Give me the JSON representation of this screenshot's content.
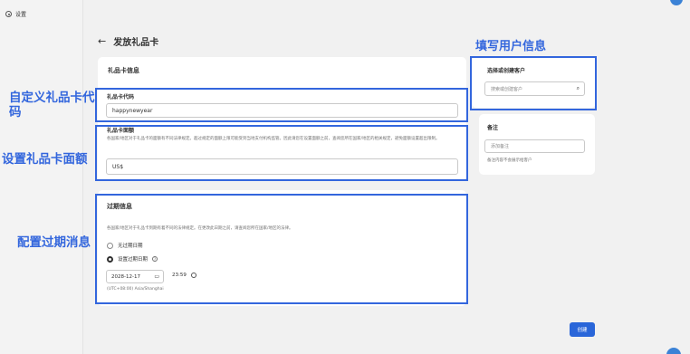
{
  "sidebar": {
    "settings_label": "设置",
    "settings_icon": "gear-icon"
  },
  "header": {
    "back_icon": "arrow-left-icon",
    "title": "发放礼品卡"
  },
  "gift_card_info": {
    "title": "礼品卡信息",
    "code_label": "礼品卡代码",
    "code_value": "happynewyear",
    "value_label": "礼品卡面额",
    "value_help": "各国家/地区对于礼品卡的面额有不同法律规定。超过规定的面额上限可能受到当地支付机构监管。因此请您在设置面额之前，查阅您所在国家/地区的相关规定，避免面额设置超出限制。",
    "value_input": "US$"
  },
  "expiry": {
    "title": "过期信息",
    "help": "各国家/地区对于礼品卡到期有着不同的法律规定。在更改此日期之前，请查阅您所在国家/地区的法律。",
    "option_no_expiry": "无过期日期",
    "option_set_expiry": "设置过期日期",
    "date_value": "2028-12-17",
    "time_value": "23:59",
    "timezone": "(UTC+08:00) Asia/Shanghai"
  },
  "customer": {
    "title": "选择或创建客户",
    "search_placeholder": "搜索或创建客户"
  },
  "notes": {
    "title": "备注",
    "placeholder": "添加备注",
    "help": "备注内容不会展示给客户"
  },
  "actions": {
    "create_label": "创建"
  },
  "annotations": {
    "customer": "填写用户信息",
    "code": "自定义礼品卡代码",
    "value": "设置礼品卡面额",
    "expiry": "配置过期消息"
  },
  "colors": {
    "annotation": "#3366dd",
    "primary_button": "#2a66d9"
  }
}
